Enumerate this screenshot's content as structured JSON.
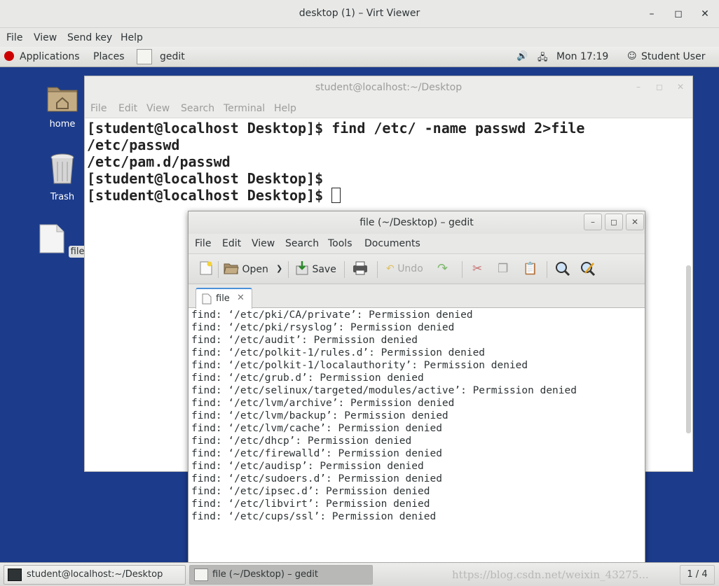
{
  "viewer": {
    "title": "desktop (1) – Virt Viewer",
    "menu": [
      "File",
      "View",
      "Send key",
      "Help"
    ]
  },
  "panel": {
    "applications": "Applications",
    "places": "Places",
    "app_name": "gedit",
    "clock": "Mon 17:19",
    "user": "Student User"
  },
  "desktop_icons": {
    "home": "home",
    "trash": "Trash",
    "file": "file"
  },
  "terminal": {
    "title": "student@localhost:~/Desktop",
    "menu": [
      "File",
      "Edit",
      "View",
      "Search",
      "Terminal",
      "Help"
    ],
    "lines": [
      "[student@localhost Desktop]$ find /etc/ -name passwd 2>file",
      "/etc/passwd",
      "/etc/pam.d/passwd",
      "[student@localhost Desktop]$ ",
      "[student@localhost Desktop]$ "
    ]
  },
  "gedit": {
    "title": "file (~/Desktop) – gedit",
    "menu": [
      "File",
      "Edit",
      "View",
      "Search",
      "Tools",
      "Documents"
    ],
    "toolbar": {
      "open": "Open",
      "save": "Save",
      "undo": "Undo"
    },
    "tab_label": "file",
    "lines": [
      "find: ‘/etc/pki/CA/private’: Permission denied",
      "find: ‘/etc/pki/rsyslog’: Permission denied",
      "find: ‘/etc/audit’: Permission denied",
      "find: ‘/etc/polkit-1/rules.d’: Permission denied",
      "find: ‘/etc/polkit-1/localauthority’: Permission denied",
      "find: ‘/etc/grub.d’: Permission denied",
      "find: ‘/etc/selinux/targeted/modules/active’: Permission denied",
      "find: ‘/etc/lvm/archive’: Permission denied",
      "find: ‘/etc/lvm/backup’: Permission denied",
      "find: ‘/etc/lvm/cache’: Permission denied",
      "find: ‘/etc/dhcp’: Permission denied",
      "find: ‘/etc/firewalld’: Permission denied",
      "find: ‘/etc/audisp’: Permission denied",
      "find: ‘/etc/sudoers.d’: Permission denied",
      "find: ‘/etc/ipsec.d’: Permission denied",
      "find: ‘/etc/libvirt’: Permission denied",
      "find: ‘/etc/cups/ssl’: Permission denied"
    ]
  },
  "taskbar": {
    "terminal_task": "student@localhost:~/Desktop",
    "gedit_task": "file (~/Desktop) – gedit",
    "workspace": "1 / 4",
    "watermark": "https://blog.csdn.net/weixin_43275..."
  }
}
